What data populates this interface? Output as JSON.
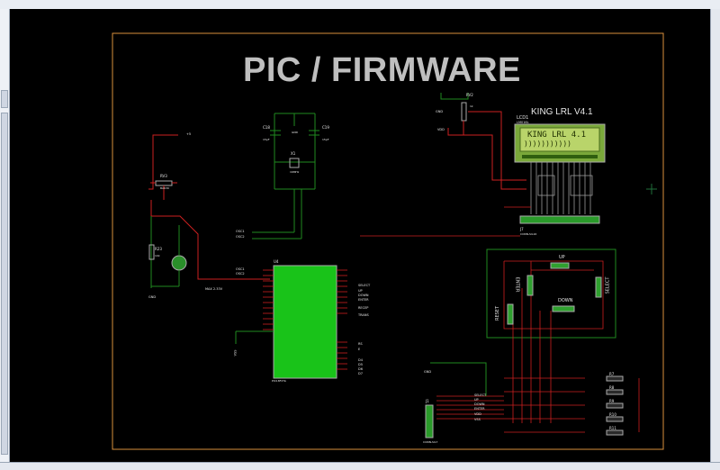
{
  "sheet": {
    "title": "PIC / FIRMWARE"
  },
  "lcd": {
    "ref": "LCD1",
    "model": "LM016L",
    "caption": "KING LRL V4.1",
    "line1": "KING LRL 4.1",
    "line2": ")))))))))))"
  },
  "components": {
    "c18": "C18",
    "c18_val": "15pF",
    "c19": "C19",
    "c19_val": "15pF",
    "x1": "X1",
    "x1_val": "16MHz",
    "gnd": "GND",
    "rv2": "RV2",
    "rv2_val": "1k",
    "rv3": "RV3",
    "rv3_val": "BAK30",
    "r23": "R23",
    "r23_val": "10k",
    "u4": "U4",
    "u4_part": "PIC18F2TA",
    "vcc": "+5",
    "vdd": "VDD",
    "max": "MAX 2.33V",
    "j7": "J7",
    "j7_part": "CONN-SIL16",
    "j1": "J1",
    "j1_part": "CONN-SIL7",
    "r7": "R7",
    "r8": "R8",
    "r9": "R9",
    "r10": "R10",
    "r11": "R11",
    "r_val": "1k"
  },
  "buttons": {
    "up": "UP",
    "down": "DOWN",
    "enter": "ENTER",
    "reset": "RESET",
    "select": "SELECT"
  },
  "nets": {
    "osc1": "OSC1",
    "osc2": "OSC2",
    "select": "SELECT",
    "up": "UP",
    "down": "DOWN",
    "enter": "ENTER",
    "reset": "RESET",
    "vss": "VSS",
    "recep": "RECEP",
    "trans": "TRANS",
    "rs": "RS",
    "e": "E",
    "d4": "D4",
    "d5": "D5",
    "d6": "D6",
    "d7": "D7"
  }
}
